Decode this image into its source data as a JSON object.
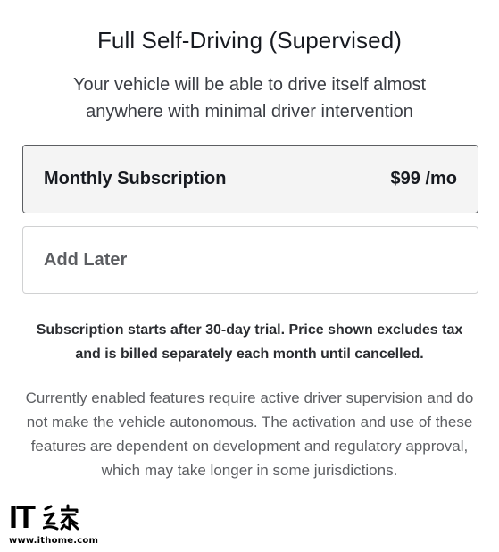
{
  "header": {
    "title": "Full Self-Driving (Supervised)",
    "subtitle": "Your vehicle will be able to drive itself almost anywhere with minimal driver intervention"
  },
  "options": [
    {
      "label": "Monthly Subscription",
      "price": "$99 /mo",
      "selected": true
    },
    {
      "label": "Add Later",
      "price": "",
      "selected": false
    }
  ],
  "disclaimer": "Subscription starts after 30-day trial. Price shown excludes tax and is billed separately each month until cancelled.",
  "notice": "Currently enabled features require active driver supervision and do not make the vehicle autonomous. The activation and use of these features are dependent on development and regulatory approval, which may take longer in some jurisdictions.",
  "watermark": {
    "logo_text": "IT之家",
    "url": "www.ithome.com"
  },
  "colors": {
    "text_primary": "#171a20",
    "text_secondary": "#5c5e62",
    "selected_bg": "#f4f4f4",
    "selected_border": "#5c5e62",
    "unselected_border": "#d0d1d2"
  }
}
